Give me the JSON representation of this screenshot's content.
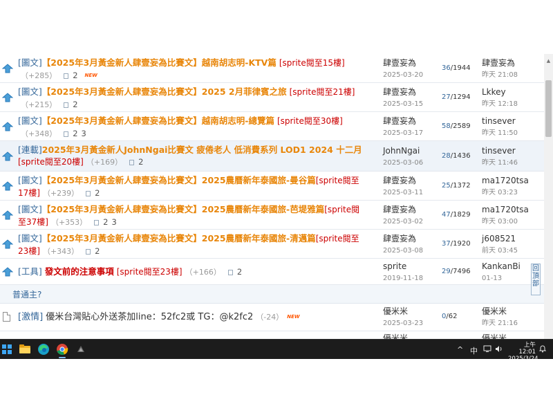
{
  "topics": [
    {
      "type": "[圖文]",
      "title": "【2025年3月黃金新人肆壹妄為比賽文】越南胡志明-KTV篇",
      "sprite": "[sprite閱至15樓]",
      "plus": "（+285）",
      "pages": [
        "2"
      ],
      "isNew": true,
      "author": "肆壹妄為",
      "date": "2025-03-20",
      "replies": "36",
      "views": "/1944",
      "last_user": "肆壹妄為",
      "last_time": "昨天 21:08"
    },
    {
      "type": "[圖文]",
      "title": "【2025年3月黃金新人肆壹妄為比賽文】2025 2月菲律賓之旅",
      "sprite": "[sprite閱至21樓]",
      "plus": "（+215）",
      "pages": [
        "2"
      ],
      "isNew": false,
      "author": "肆壹妄為",
      "date": "2025-03-15",
      "replies": "27",
      "views": "/1294",
      "last_user": "Lkkey",
      "last_time": "昨天 12:18"
    },
    {
      "type": "[圖文]",
      "title": "【2025年3月黃金新人肆壹妄為比賽文】越南胡志明-總覽篇",
      "sprite": "[sprite閱至30樓]",
      "plus": "（+348）",
      "pages": [
        "2",
        "3"
      ],
      "isNew": false,
      "author": "肆壹妄為",
      "date": "2025-03-17",
      "replies": "58",
      "views": "/2589",
      "last_user": "tinsever",
      "last_time": "昨天 11:50"
    },
    {
      "type": "[連載]",
      "title": "2025年3月黃金新人JohnNgai比賽文  疲倦老人 低消費系列 LOD1 2024 十二月",
      "sprite": "[sprite閱至20樓]",
      "plus": "（+169）",
      "pages": [
        "2"
      ],
      "isNew": false,
      "author": "JohnNgai",
      "date": "2025-03-06",
      "replies": "28",
      "views": "/1436",
      "last_user": "tinsever",
      "last_time": "昨天 11:46"
    },
    {
      "type": "[圖文]",
      "title": "【2025年3月黃金新人肆壹妄為比賽文】2025農曆新年泰國旅-曼谷篇",
      "sprite": "[sprite閱至17樓]",
      "plus": "（+239）",
      "pages": [
        "2"
      ],
      "isNew": false,
      "author": "肆壹妄為",
      "date": "2025-03-11",
      "replies": "25",
      "views": "/1372",
      "last_user": "ma1720tsa",
      "last_time": "昨天 03:23"
    },
    {
      "type": "[圖文]",
      "title": "【2025年3月黃金新人肆壹妄為比賽文】2025農曆新年泰國旅-芭堤雅篇",
      "sprite": "[sprite閱至37樓]",
      "plus": "（+353）",
      "pages": [
        "2",
        "3"
      ],
      "isNew": false,
      "author": "肆壹妄為",
      "date": "2025-03-02",
      "replies": "47",
      "views": "/1829",
      "last_user": "ma1720tsa",
      "last_time": "昨天 03:00"
    },
    {
      "type": "[圖文]",
      "title": "【2025年3月黃金新人肆壹妄為比賽文】2025農曆新年泰國旅-清邁篇",
      "sprite": "[sprite閱至23樓]",
      "plus": "（+343）",
      "pages": [
        "2"
      ],
      "isNew": false,
      "author": "肆壹妄為",
      "date": "2025-03-08",
      "replies": "37",
      "views": "/1920",
      "last_user": "j608521",
      "last_time": "前天 03:45"
    },
    {
      "type": "[工具]",
      "title": "發文前的注意事項",
      "sprite": "[sprite閱至23樓]",
      "plus": "（+166）",
      "pages": [
        "2"
      ],
      "isNew": false,
      "author": "sprite",
      "date": "2019-11-18",
      "replies": "29",
      "views": "/7496",
      "last_user": "KankanBi",
      "last_time": "01-13"
    }
  ],
  "section_label": "普通主?",
  "normal_topics": [
    {
      "type": "[激情]",
      "title": "優米台灣貼心外送茶加line：52fc2或 TG：@k2fc2",
      "plus": "（-24）",
      "isNew": true,
      "author": "優米米",
      "date": "2025-03-23",
      "replies": "0",
      "views": "/62",
      "last_user": "優米米",
      "last_time": "昨天 21:16"
    },
    {
      "type": "",
      "title": "",
      "plus": "",
      "isNew": false,
      "author": "優米米",
      "date": "",
      "replies": "",
      "views": "",
      "last_user": "優米米",
      "last_time": ""
    }
  ],
  "new_badge": "NEW",
  "back_to_top": "回頂部",
  "taskbar": {
    "tray_chevron": "^",
    "ime": "中",
    "clock_time": "上午 12:01",
    "clock_date": "2025/3/24",
    "icons": [
      "windows-start-icon",
      "file-explorer-icon",
      "edge-browser-icon",
      "chrome-browser-icon",
      "app-icon"
    ]
  },
  "colors": {
    "title_orange": "#e8860a",
    "sprite_red": "#cc0000",
    "link_blue": "#336699",
    "arrow_blue": "#4a9fd8"
  }
}
